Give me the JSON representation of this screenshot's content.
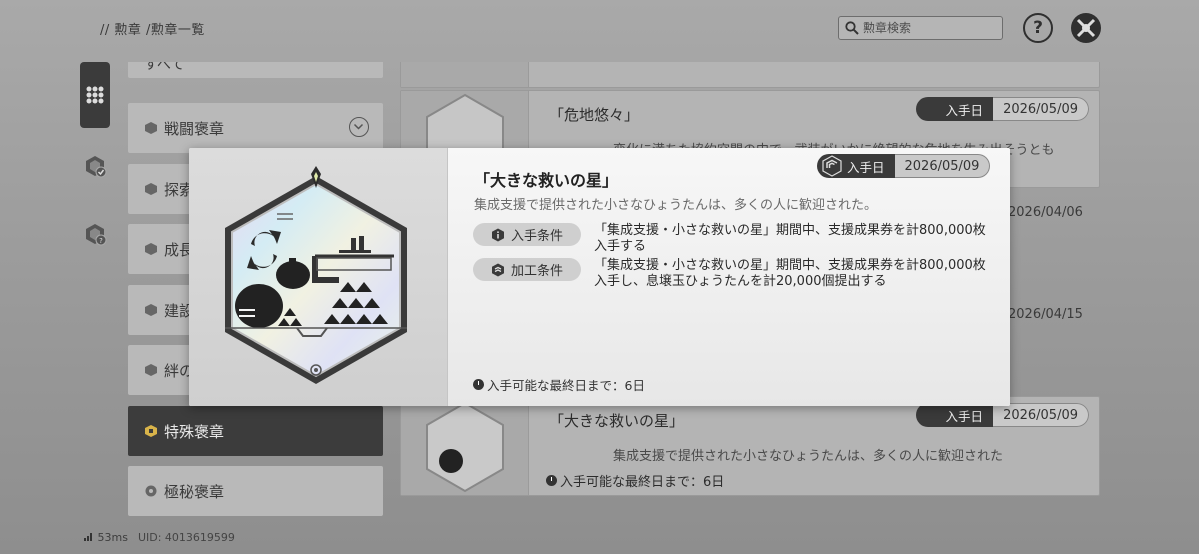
{
  "header": {
    "breadcrumb": "// 勲章 /勲章一覧",
    "search_placeholder": "勲章検索",
    "help_label": "?"
  },
  "categories": {
    "all_label": "すべて",
    "items": [
      {
        "label": "戦闘褒章"
      },
      {
        "label": "探索"
      },
      {
        "label": "成長"
      },
      {
        "label": "建設"
      },
      {
        "label": "絆の"
      },
      {
        "label": "特殊褒章"
      },
      {
        "label": "極秘褒章"
      }
    ]
  },
  "badges": [
    {
      "name": "「危地悠々」",
      "desc": "変化に満ちた協約空間の中で、武装がいかに絶望的な危地を生み出そうとも",
      "date_label": "入手日",
      "date": "2026/05/09"
    },
    {
      "name": "「大きな救いの星」",
      "desc": "集成支援で提供された小さなひょうたんは、多くの人に歓迎された",
      "date_label": "入手日",
      "date": "2026/05/09",
      "deadline": "入手可能な最終日まで：6日"
    }
  ],
  "side_dates": [
    "2026/04/06",
    "2026/04/15"
  ],
  "modal": {
    "date_label": "入手日",
    "date": "2026/05/09",
    "title": "「大きな救いの星」",
    "desc": "集成支援で提供された小さなひょうたんは、多くの人に歓迎された。",
    "conditions": [
      {
        "label": "入手条件",
        "icon": "info-hex-icon",
        "text": "「集成支援・小さな救いの星」期間中、支援成果券を計800,000枚入手する"
      },
      {
        "label": "加工条件",
        "icon": "layers-hex-icon",
        "text": "「集成支援・小さな救いの星」期間中、支援成果券を計800,000枚入手し、息壌玉ひょうたんを計20,000個提出する"
      }
    ],
    "deadline": "入手可能な最終日まで：6日"
  },
  "status": {
    "ping": "53ms",
    "uid": "UID: 4013619599"
  }
}
